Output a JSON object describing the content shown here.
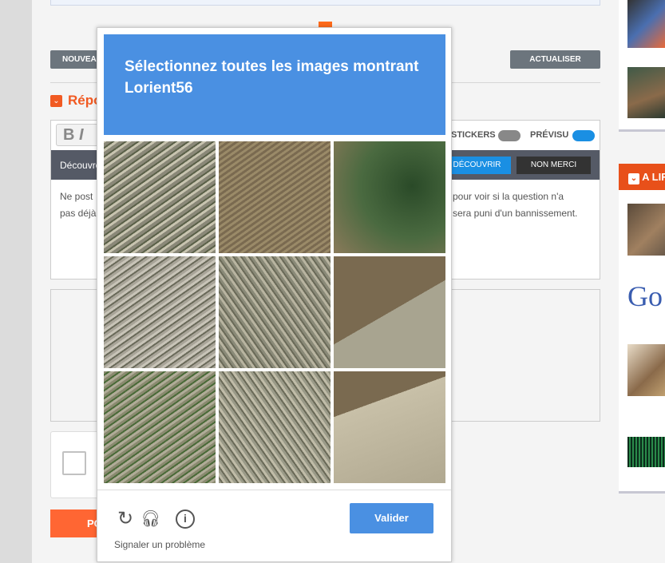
{
  "page": {
    "new_button": "NOUVEAU SUJET",
    "refresh_button": "ACTUALISER",
    "reply_title": "Répondre",
    "toolbar_bold": "B",
    "toolbar_italic": "I",
    "stickers_label": "STICKERS",
    "preview_label": "PRÉVISU",
    "banner_text": "Découvrez",
    "discover_button": "DÉCOUVRIR",
    "no_thanks_button": "NON MERCI",
    "editor_line1_left": "Ne post",
    "editor_line2_left": "pas déjà",
    "editor_line1_right": "pour voir si la question n'a",
    "editor_line2_right": "sera puni d'un bannissement.",
    "post_button": "POSTER"
  },
  "sidebar": {
    "section_title": "A LIRE",
    "google_logo": "Go"
  },
  "captcha": {
    "instruction": "Sélectionnez toutes les images montrant Lorient56",
    "tiles": [
      1,
      2,
      3,
      4,
      5,
      6,
      7,
      8,
      9
    ],
    "verify_button": "Valider",
    "report_link": "Signaler un problème",
    "icons": [
      "reload-icon",
      "headphones-icon",
      "info-icon"
    ],
    "accent": "#4a90e2"
  }
}
